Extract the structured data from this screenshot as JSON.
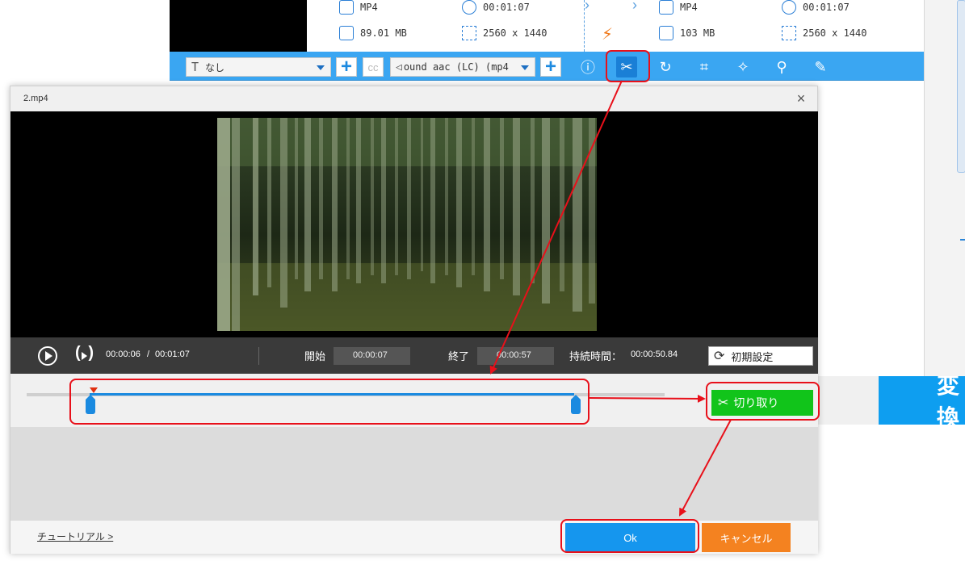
{
  "background": {
    "source": {
      "format": "MP4",
      "duration": "00:01:07",
      "size": "89.01 MB",
      "resolution": "2560 x 1440"
    },
    "output": {
      "format": "MP4",
      "duration": "00:01:07",
      "size": "103 MB",
      "resolution": "2560 x 1440"
    },
    "toolbar": {
      "subtitle_value": "なし",
      "audio_value": "ound aac (LC) (mp4"
    },
    "convert_label": "変換"
  },
  "dialog": {
    "title": "2.mp4",
    "close_glyph": "×",
    "controls": {
      "current_time": "00:00:06",
      "separator": "/",
      "total_time": "00:01:07",
      "start_label": "開始",
      "start_value": "00:00:07",
      "end_label": "終了",
      "end_value": "00:00:57",
      "duration_label": "持続時間：",
      "duration_value": "00:00:50.84",
      "reset_label": "初期設定"
    },
    "cut_label": "切り取り",
    "tutorial_link": "チュートリアル >",
    "ok_label": "Ok",
    "cancel_label": "キャンセル"
  },
  "colors": {
    "accent": "#3aa6f2",
    "cut_button": "#11c41a",
    "ok_button": "#1596ee",
    "cancel_button": "#f48220",
    "highlight": "#e8101a"
  }
}
